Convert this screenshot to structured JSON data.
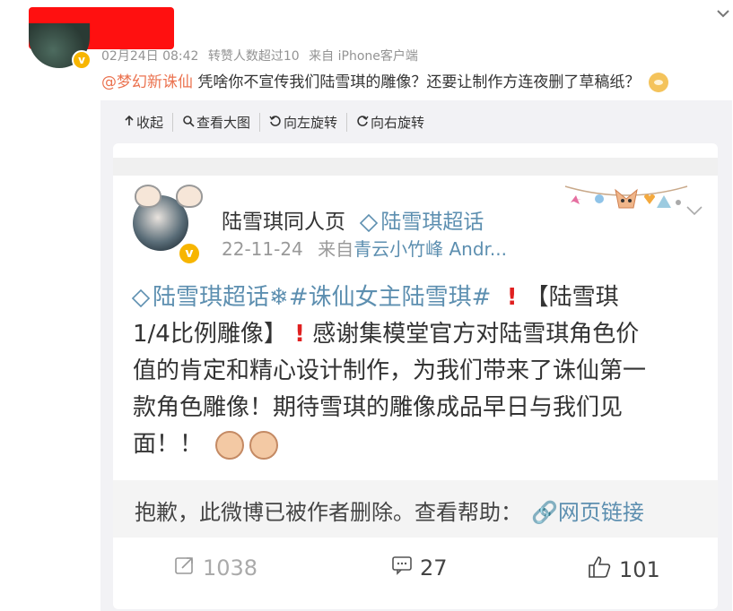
{
  "comment": {
    "timestamp": "02月24日 08:42",
    "reposts": "转赞人数超过10",
    "source": "来自 iPhone客户端",
    "mention": "@梦幻新诛仙",
    "text": "凭啥你不宣传我们陆雪琪的雕像？还要让制作方连夜删了草稿纸？"
  },
  "toolbar": {
    "collapse": "收起",
    "view_large": "查看大图",
    "rotate_left": "向左旋转",
    "rotate_right": "向右旋转"
  },
  "screenshot": {
    "author": "陆雪琪同人页",
    "topic_tag": "陆雪琪超话",
    "date": "22-11-24",
    "source_prefix": "来自",
    "source": "青云小竹峰 Andr...",
    "body_topic": "陆雪琪超话",
    "body_hashtag": "#诛仙女主陆雪琪#",
    "body_line1_tail": "【陆雪琪",
    "body_line2": "1/4比例雕像】",
    "body_line2_tail": "感谢集模堂官方对陆雪琪角色价",
    "body_line3": "值的肯定和精心设计制作，为我们带来了诛仙第一",
    "body_line4": "款角色雕像！期待雪琪的雕像成品早日与我们见",
    "body_line5": "面！！",
    "deleted_notice": "抱歉，此微博已被作者删除。查看帮助：",
    "deleted_link": "网页链接",
    "repost_count": "1038",
    "comment_count": "27",
    "like_count": "101"
  },
  "icons": {
    "collapse": "arrow-up-icon",
    "zoom": "magnifier-icon",
    "rotate_left": "rotate-left-icon",
    "rotate_right": "rotate-right-icon"
  },
  "colors": {
    "mention": "#eb7350",
    "topic": "#5d8fb0",
    "redaction": "#ff1010",
    "verified": "#f7b500"
  }
}
